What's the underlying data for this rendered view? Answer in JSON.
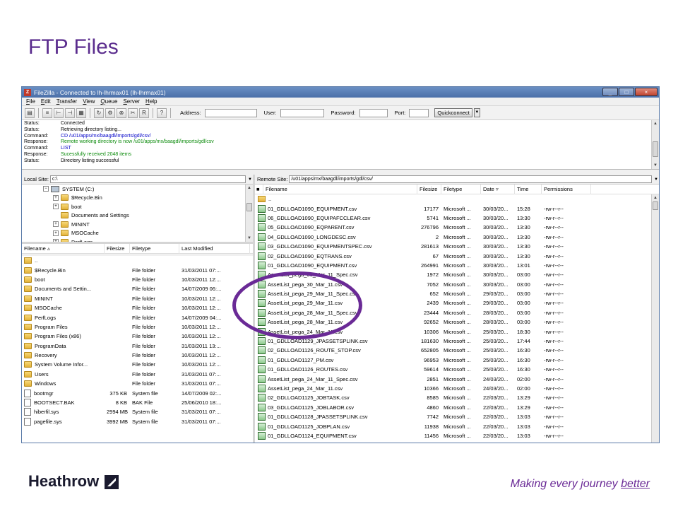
{
  "slide": {
    "title": "FTP Files",
    "brand": "Heathrow",
    "tagline_pre": "Making every journey ",
    "tagline_em": "better"
  },
  "window": {
    "title": "FileZilla - Connected to lh-lhrmax01 (lh-lhrmax01)",
    "menu": [
      "File",
      "Edit",
      "Transfer",
      "View",
      "Queue",
      "Server",
      "Help"
    ],
    "quickconnect": {
      "address_label": "Address:",
      "user_label": "User:",
      "password_label": "Password:",
      "port_label": "Port:",
      "button": "Quickconnect"
    }
  },
  "log": [
    {
      "k": "Status:",
      "v": "Connected",
      "t": "status"
    },
    {
      "k": "Status:",
      "v": "Retrieving directory listing...",
      "t": "status"
    },
    {
      "k": "Command:",
      "v": "CD /u01/apps/mx/baagdl/imports/gdl/csv/",
      "t": "cmd"
    },
    {
      "k": "Response:",
      "v": "Remote working directory is now /u01/apps/mx/baagdl/imports/gdl/csv",
      "t": "resp"
    },
    {
      "k": "Command:",
      "v": "LIST",
      "t": "cmd"
    },
    {
      "k": "Response:",
      "v": "Sucessfully received 2048 items",
      "t": "resp"
    },
    {
      "k": "Status:",
      "v": "Directory listing successful",
      "t": "status"
    }
  ],
  "local": {
    "site_label": "Local Site:",
    "site_value": "c:\\",
    "tree": [
      {
        "label": "SYSTEM (C:)",
        "indent": 0,
        "drive": true
      },
      {
        "label": "$Recycle.Bin",
        "indent": 1
      },
      {
        "label": "boot",
        "indent": 1
      },
      {
        "label": "Documents and Settings",
        "indent": 1
      },
      {
        "label": "MININT",
        "indent": 1
      },
      {
        "label": "MSOCache",
        "indent": 1
      },
      {
        "label": "PerfLogs",
        "indent": 1
      }
    ],
    "headers": {
      "name": "Filename",
      "size": "Filesize",
      "type": "Filetype",
      "modified": "Last Modified"
    },
    "files": [
      {
        "name": "..",
        "size": "",
        "type": "",
        "modified": "",
        "kind": "up"
      },
      {
        "name": "$Recycle.Bin",
        "size": "",
        "type": "File folder",
        "modified": "31/03/2011 07:...",
        "kind": "folder"
      },
      {
        "name": "boot",
        "size": "",
        "type": "File folder",
        "modified": "10/03/2011 12:...",
        "kind": "folder"
      },
      {
        "name": "Documents and Settin...",
        "size": "",
        "type": "File folder",
        "modified": "14/07/2009 06:...",
        "kind": "folder"
      },
      {
        "name": "MININT",
        "size": "",
        "type": "File folder",
        "modified": "10/03/2011 12:...",
        "kind": "folder"
      },
      {
        "name": "MSOCache",
        "size": "",
        "type": "File folder",
        "modified": "10/03/2011 12:...",
        "kind": "folder"
      },
      {
        "name": "PerfLogs",
        "size": "",
        "type": "File folder",
        "modified": "14/07/2009 04:...",
        "kind": "folder"
      },
      {
        "name": "Program Files",
        "size": "",
        "type": "File folder",
        "modified": "10/03/2011 12:...",
        "kind": "folder"
      },
      {
        "name": "Program Files (x86)",
        "size": "",
        "type": "File folder",
        "modified": "10/03/2011 12:...",
        "kind": "folder"
      },
      {
        "name": "ProgramData",
        "size": "",
        "type": "File folder",
        "modified": "31/03/2011 13:...",
        "kind": "folder"
      },
      {
        "name": "Recovery",
        "size": "",
        "type": "File folder",
        "modified": "10/03/2011 12:...",
        "kind": "folder"
      },
      {
        "name": "System Volume Infor...",
        "size": "",
        "type": "File folder",
        "modified": "10/03/2011 12:...",
        "kind": "folder"
      },
      {
        "name": "Users",
        "size": "",
        "type": "File folder",
        "modified": "31/03/2011 07:...",
        "kind": "folder"
      },
      {
        "name": "Windows",
        "size": "",
        "type": "File folder",
        "modified": "31/03/2011 07:...",
        "kind": "folder"
      },
      {
        "name": "bootmgr",
        "size": "375 KB",
        "type": "System file",
        "modified": "14/07/2009 02:...",
        "kind": "file"
      },
      {
        "name": "BOOTSECT.BAK",
        "size": "8 KB",
        "type": "BAK File",
        "modified": "25/06/2010 18:...",
        "kind": "file"
      },
      {
        "name": "hiberfil.sys",
        "size": "2994 MB",
        "type": "System file",
        "modified": "31/03/2011 07:...",
        "kind": "file"
      },
      {
        "name": "pagefile.sys",
        "size": "3992 MB",
        "type": "System file",
        "modified": "31/03/2011 07:...",
        "kind": "file"
      }
    ]
  },
  "remote": {
    "site_label": "Remote Site:",
    "site_value": "/u01/apps/mx/baagdl/imports/gdl/csv/",
    "headers": {
      "name": "Filename",
      "size": "Filesize",
      "type": "Filetype",
      "date": "Date",
      "time": "Time",
      "perm": "Permissions"
    },
    "files": [
      {
        "name": "..",
        "size": "",
        "type": "",
        "date": "",
        "time": "",
        "perm": "",
        "kind": "up"
      },
      {
        "name": "01_GDLLOAD1090_EQUIPMENT.csv",
        "size": "17177",
        "type": "Microsoft ...",
        "date": "30/03/20...",
        "time": "15:28",
        "perm": "-rw-r--r--",
        "kind": "csv"
      },
      {
        "name": "06_GDLLOAD1090_EQUIPAFCCLEAR.csv",
        "size": "5741",
        "type": "Microsoft ...",
        "date": "30/03/20...",
        "time": "13:30",
        "perm": "-rw-r--r--",
        "kind": "csv"
      },
      {
        "name": "05_GDLLOAD1090_EQPARENT.csv",
        "size": "276796",
        "type": "Microsoft ...",
        "date": "30/03/20...",
        "time": "13:30",
        "perm": "-rw-r--r--",
        "kind": "csv"
      },
      {
        "name": "04_GDLLOAD1090_LONGDESC.csv",
        "size": "2",
        "type": "Microsoft ...",
        "date": "30/03/20...",
        "time": "13:30",
        "perm": "-rw-r--r--",
        "kind": "csv"
      },
      {
        "name": "03_GDLLOAD1090_EQUIPMENTSPEC.csv",
        "size": "281613",
        "type": "Microsoft ...",
        "date": "30/03/20...",
        "time": "13:30",
        "perm": "-rw-r--r--",
        "kind": "csv"
      },
      {
        "name": "02_GDLLOAD1090_EQTRANS.csv",
        "size": "67",
        "type": "Microsoft ...",
        "date": "30/03/20...",
        "time": "13:30",
        "perm": "-rw-r--r--",
        "kind": "csv"
      },
      {
        "name": "01_GDLLOAD1090_EQUIPMENT.csv",
        "size": "264991",
        "type": "Microsoft ...",
        "date": "30/03/20...",
        "time": "13:01",
        "perm": "-rw-r--r--",
        "kind": "csv"
      },
      {
        "name": "AssetList_pega_30_Mar_11_Spec.csv",
        "size": "1972",
        "type": "Microsoft ...",
        "date": "30/03/20...",
        "time": "03:00",
        "perm": "-rw-r--r--",
        "kind": "csv"
      },
      {
        "name": "AssetList_pega_30_Mar_11.csv",
        "size": "7052",
        "type": "Microsoft ...",
        "date": "30/03/20...",
        "time": "03:00",
        "perm": "-rw-r--r--",
        "kind": "csv"
      },
      {
        "name": "AssetList_pega_29_Mar_11_Spec.csv",
        "size": "652",
        "type": "Microsoft ...",
        "date": "29/03/20...",
        "time": "03:00",
        "perm": "-rw-r--r--",
        "kind": "csv"
      },
      {
        "name": "AssetList_pega_29_Mar_11.csv",
        "size": "2439",
        "type": "Microsoft ...",
        "date": "29/03/20...",
        "time": "03:00",
        "perm": "-rw-r--r--",
        "kind": "csv"
      },
      {
        "name": "AssetList_pega_28_Mar_11_Spec.csv",
        "size": "23444",
        "type": "Microsoft ...",
        "date": "28/03/20...",
        "time": "03:00",
        "perm": "-rw-r--r--",
        "kind": "csv"
      },
      {
        "name": "AssetList_pega_28_Mar_11.csv",
        "size": "92652",
        "type": "Microsoft ...",
        "date": "28/03/20...",
        "time": "03:00",
        "perm": "-rw-r--r--",
        "kind": "csv"
      },
      {
        "name": "AssetList_pega_24_Mar_11.csv",
        "size": "10306",
        "type": "Microsoft ...",
        "date": "25/03/20...",
        "time": "18:30",
        "perm": "-rw-r--r--",
        "kind": "csv"
      },
      {
        "name": "01_GDLLOAD1129_JPASSETSPLINK.csv",
        "size": "181630",
        "type": "Microsoft ...",
        "date": "25/03/20...",
        "time": "17:44",
        "perm": "-rw-r--r--",
        "kind": "csv"
      },
      {
        "name": "02_GDLLOAD1126_ROUTE_STOP.csv",
        "size": "652805",
        "type": "Microsoft ...",
        "date": "25/03/20...",
        "time": "16:30",
        "perm": "-rw-r--r--",
        "kind": "csv"
      },
      {
        "name": "01_GDLLOAD1127_PM.csv",
        "size": "96953",
        "type": "Microsoft ...",
        "date": "25/03/20...",
        "time": "16:30",
        "perm": "-rw-r--r--",
        "kind": "csv"
      },
      {
        "name": "01_GDLLOAD1126_ROUTES.csv",
        "size": "59614",
        "type": "Microsoft ...",
        "date": "25/03/20...",
        "time": "16:30",
        "perm": "-rw-r--r--",
        "kind": "csv"
      },
      {
        "name": "AssetList_pega_24_Mar_11_Spec.csv",
        "size": "2851",
        "type": "Microsoft ...",
        "date": "24/03/20...",
        "time": "02:00",
        "perm": "-rw-r--r--",
        "kind": "csv"
      },
      {
        "name": "AssetList_pega_24_Mar_11.csv",
        "size": "10366",
        "type": "Microsoft ...",
        "date": "24/03/20...",
        "time": "02:00",
        "perm": "-rw-r--r--",
        "kind": "csv"
      },
      {
        "name": "02_GDLLOAD1125_JOBTASK.csv",
        "size": "8585",
        "type": "Microsoft ...",
        "date": "22/03/20...",
        "time": "13:29",
        "perm": "-rw-r--r--",
        "kind": "csv"
      },
      {
        "name": "03_GDLLOAD1125_JOBLABOR.csv",
        "size": "4860",
        "type": "Microsoft ...",
        "date": "22/03/20...",
        "time": "13:29",
        "perm": "-rw-r--r--",
        "kind": "csv"
      },
      {
        "name": "01_GDLLOAD1128_JPASSETSPLINK.csv",
        "size": "7742",
        "type": "Microsoft ...",
        "date": "22/03/20...",
        "time": "13:03",
        "perm": "-rw-r--r--",
        "kind": "csv"
      },
      {
        "name": "01_GDLLOAD1125_JOBPLAN.csv",
        "size": "11938",
        "type": "Microsoft ...",
        "date": "22/03/20...",
        "time": "13:03",
        "perm": "-rw-r--r--",
        "kind": "csv"
      },
      {
        "name": "01_GDLLOAD1124_EQUIPMENT.csv",
        "size": "11456",
        "type": "Microsoft ...",
        "date": "22/03/20...",
        "time": "13:03",
        "perm": "-rw-r--r--",
        "kind": "csv"
      }
    ]
  }
}
